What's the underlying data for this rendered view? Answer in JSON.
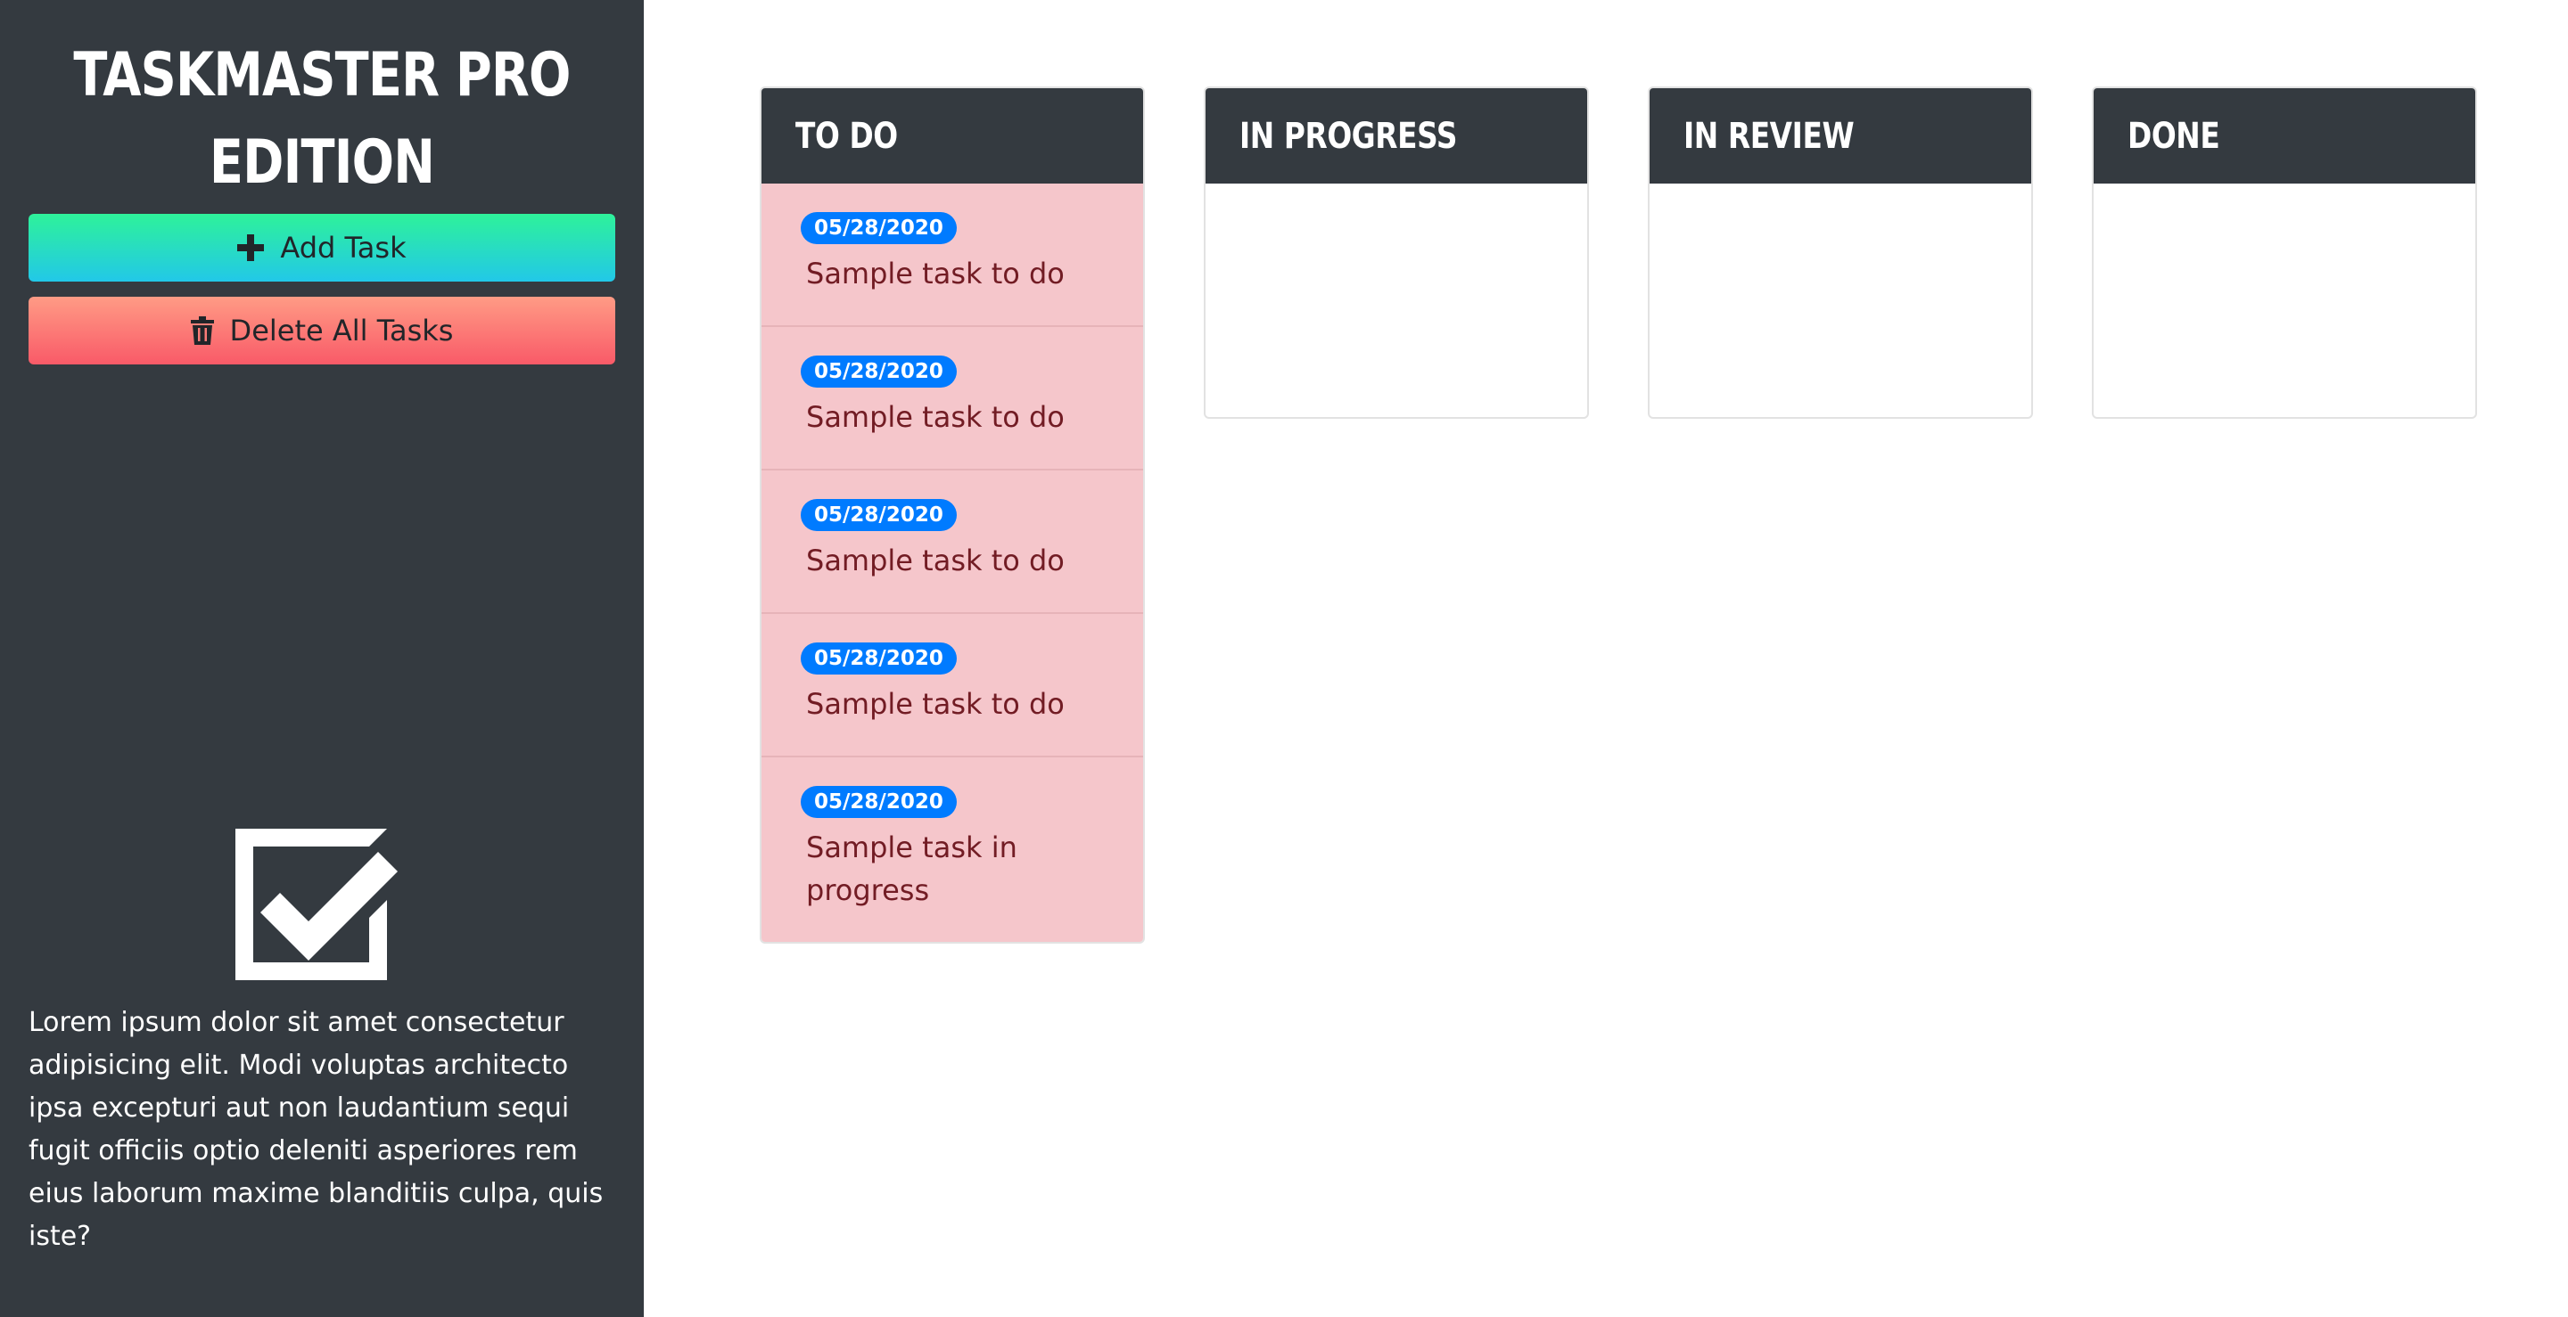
{
  "sidebar": {
    "brand_line1": "Taskmaster Pro",
    "brand_line2": "Edition",
    "add_label": "Add Task",
    "add_icon": "plus-icon",
    "delete_label": "Delete All Tasks",
    "delete_icon": "trash-icon",
    "logo_icon": "checkbox-checked-icon",
    "about": "Lorem ipsum dolor sit amet consectetur adipisicing elit. Modi voluptas architecto ipsa excepturi aut non laudantium sequi fugit officiis optio deleniti asperiores rem eius laborum maxime blanditiis culpa, quis iste?"
  },
  "columns": [
    {
      "title": "To Do",
      "tasks": [
        {
          "date": "05/28/2020",
          "text": "Sample task to do"
        },
        {
          "date": "05/28/2020",
          "text": "Sample task to do"
        },
        {
          "date": "05/28/2020",
          "text": "Sample task to do"
        },
        {
          "date": "05/28/2020",
          "text": "Sample task to do"
        },
        {
          "date": "05/28/2020",
          "text": "Sample task in progress"
        }
      ]
    },
    {
      "title": "In Progress",
      "tasks": []
    },
    {
      "title": "In Review",
      "tasks": []
    },
    {
      "title": "Done",
      "tasks": []
    }
  ],
  "colors": {
    "sidebar_bg": "#343a40",
    "badge": "#007bff",
    "task_bg": "#f5c6cb",
    "task_text": "#721c24"
  }
}
